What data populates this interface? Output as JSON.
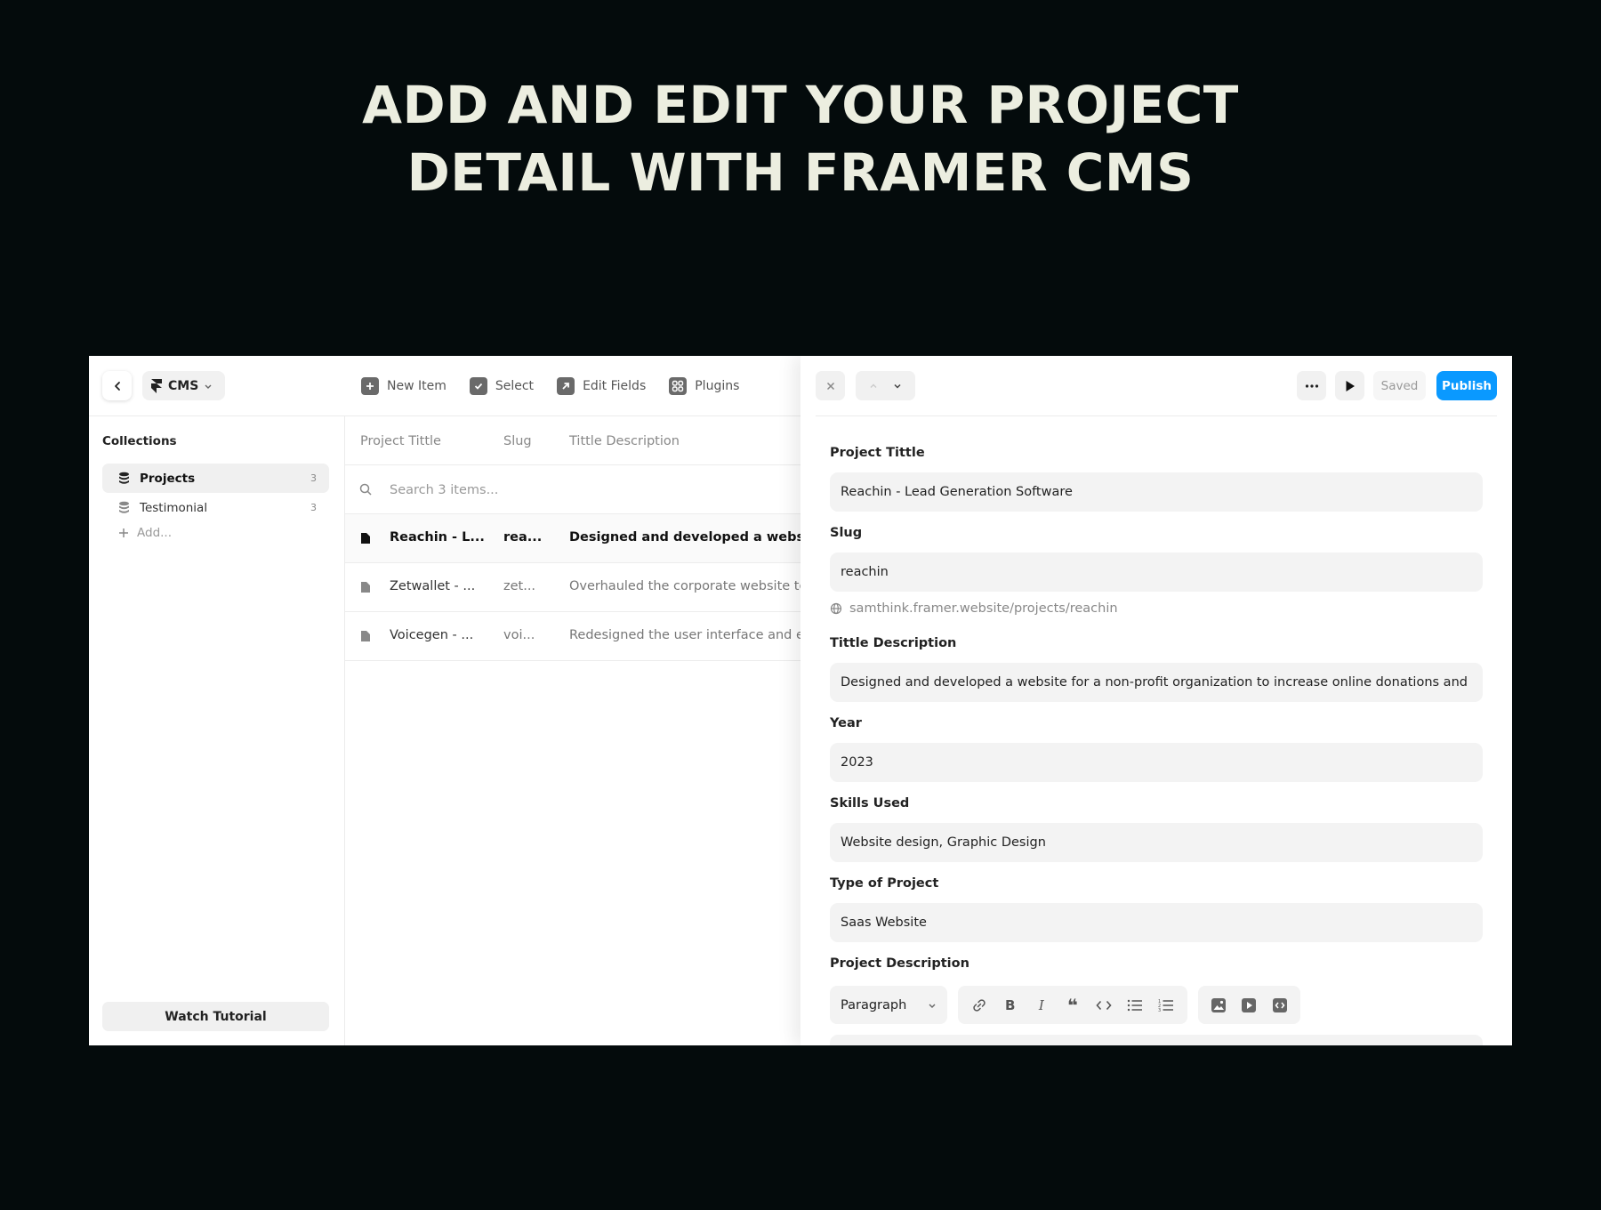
{
  "hero": {
    "line1": "ADD AND EDIT YOUR PROJECT",
    "line2": "DETAIL WITH FRAMER CMS"
  },
  "topbar": {
    "cms_label": "CMS"
  },
  "toolbar": {
    "new_item": "New Item",
    "select": "Select",
    "edit_fields": "Edit Fields",
    "plugins": "Plugins"
  },
  "sidebar": {
    "title": "Collections",
    "items": [
      {
        "label": "Projects",
        "count": "3"
      },
      {
        "label": "Testimonial",
        "count": "3"
      }
    ],
    "add_label": "Add...",
    "watch_tutorial": "Watch Tutorial"
  },
  "list": {
    "headers": {
      "title": "Project Tittle",
      "slug": "Slug",
      "desc": "Tittle Description"
    },
    "search_placeholder": "Search 3 items...",
    "rows": [
      {
        "title": "Reachin - L...",
        "slug": "rea...",
        "desc": "Designed and developed a website for"
      },
      {
        "title": "Zetwallet - ...",
        "slug": "zet...",
        "desc": "Overhauled the corporate website to i"
      },
      {
        "title": "Voicegen - ...",
        "slug": "voi...",
        "desc": "Redesigned the user interface and enh"
      }
    ]
  },
  "detail": {
    "saved": "Saved",
    "publish": "Publish",
    "fields": {
      "title_label": "Project Tittle",
      "title_value": "Reachin - Lead Generation Software",
      "slug_label": "Slug",
      "slug_value": "reachin",
      "url": "samthink.framer.website/projects/reachin",
      "desc_label": "Tittle Description",
      "desc_value": "Designed and developed a website for a non-profit organization to increase online donations and vol...",
      "year_label": "Year",
      "year_value": "2023",
      "skills_label": "Skills Used",
      "skills_value": "Website design, Graphic Design",
      "type_label": "Type of Project",
      "type_value": "Saas Website",
      "project_desc_label": "Project Description",
      "paragraph_select": "Paragraph"
    }
  },
  "colors": {
    "background": "#040b0c",
    "hero_text": "#eceee0",
    "publish": "#0a99ff"
  }
}
